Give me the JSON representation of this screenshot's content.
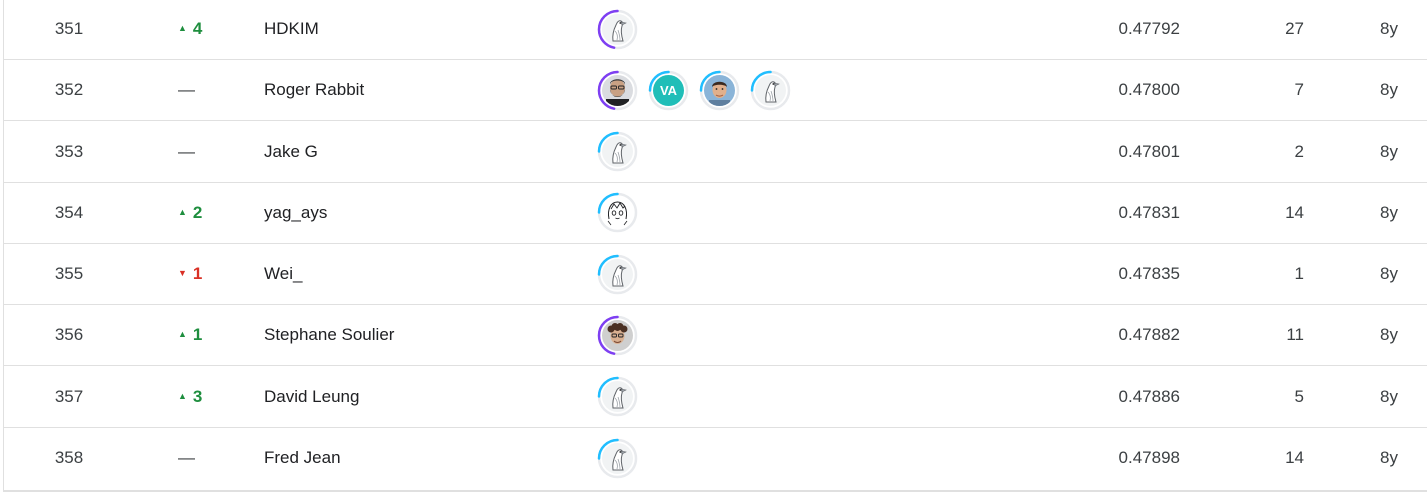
{
  "colors": {
    "ring_purple": "#7e3ff2",
    "ring_cyan": "#20beff",
    "ring_track": "#e8eaed",
    "up": "#1e8e3e",
    "down": "#d93025",
    "initials_bg": "#20beb8"
  },
  "rows": [
    {
      "rank": "351",
      "delta": "4",
      "dir": "up",
      "team": "HDKIM",
      "members": [
        {
          "kind": "goose",
          "tier": "purple"
        }
      ],
      "score": "0.47792",
      "entries": "27",
      "last": "8y"
    },
    {
      "rank": "352",
      "delta": "—",
      "dir": "same",
      "team": "Roger Rabbit",
      "members": [
        {
          "kind": "photo-beard",
          "tier": "purple"
        },
        {
          "kind": "initials",
          "initials": "VA",
          "tier": "cyan"
        },
        {
          "kind": "photo-young",
          "tier": "cyan"
        },
        {
          "kind": "goose",
          "tier": "cyan"
        }
      ],
      "score": "0.47800",
      "entries": "7",
      "last": "8y"
    },
    {
      "rank": "353",
      "delta": "—",
      "dir": "same",
      "team": "Jake G",
      "members": [
        {
          "kind": "goose",
          "tier": "cyan"
        }
      ],
      "score": "0.47801",
      "entries": "2",
      "last": "8y"
    },
    {
      "rank": "354",
      "delta": "2",
      "dir": "up",
      "team": "yag_ays",
      "members": [
        {
          "kind": "sketch",
          "tier": "cyan"
        }
      ],
      "score": "0.47831",
      "entries": "14",
      "last": "8y"
    },
    {
      "rank": "355",
      "delta": "1",
      "dir": "down",
      "team": "Wei_",
      "members": [
        {
          "kind": "goose",
          "tier": "cyan"
        }
      ],
      "score": "0.47835",
      "entries": "1",
      "last": "8y"
    },
    {
      "rank": "356",
      "delta": "1",
      "dir": "up",
      "team": "Stephane Soulier",
      "members": [
        {
          "kind": "photo-curly",
          "tier": "purple"
        }
      ],
      "score": "0.47882",
      "entries": "11",
      "last": "8y"
    },
    {
      "rank": "357",
      "delta": "3",
      "dir": "up",
      "team": "David Leung",
      "members": [
        {
          "kind": "goose",
          "tier": "cyan"
        }
      ],
      "score": "0.47886",
      "entries": "5",
      "last": "8y"
    },
    {
      "rank": "358",
      "delta": "—",
      "dir": "same",
      "team": "Fred Jean",
      "members": [
        {
          "kind": "goose",
          "tier": "cyan"
        }
      ],
      "score": "0.47898",
      "entries": "14",
      "last": "8y"
    }
  ]
}
